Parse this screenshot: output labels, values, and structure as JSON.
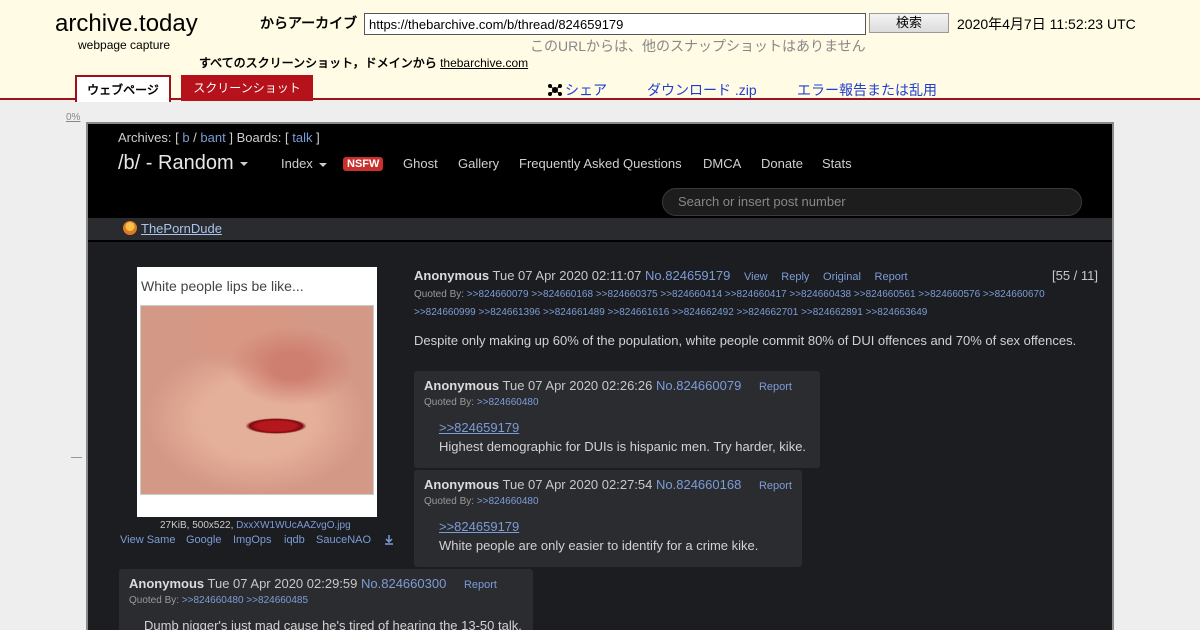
{
  "archive_header": {
    "logo": "archive.today",
    "logo_sub": "webpage capture",
    "from_label": "からアーカイブ",
    "url_value": "https://thebarchive.com/b/thread/824659179",
    "search_button": "検索",
    "capture_date": "2020年4月7日 11:52:23 UTC",
    "no_snapshots": "このURLからは、他のスナップショットはありません",
    "all_screenshots_label": "すべてのスクリーンショット，ドメインから",
    "domain_link": "thebarchive.com",
    "tabs": [
      "ウェブページ",
      "スクリーンショット"
    ],
    "share": "シェア",
    "download": "ダウンロード .zip",
    "report": "エラー報告または乱用"
  },
  "rail": {
    "percent": "0%"
  },
  "board": {
    "archives_prefix": "Archives: [",
    "archive_b": "b",
    "archive_sep": "/",
    "archive_bant": "bant",
    "boards_prefix": "] Boards: [",
    "board_talk": "talk",
    "boards_suffix": "]",
    "title": "/b/ - Random",
    "nav": [
      "Index",
      "NSFW",
      "Ghost",
      "Gallery",
      "Frequently Asked Questions",
      "DMCA",
      "Donate",
      "Stats"
    ],
    "search_placeholder": "Search or insert post number",
    "ad_link": "ThePornDude"
  },
  "op": {
    "image_caption": "White people lips be like...",
    "file_info": "27KiB, 500x522,",
    "file_name": "DxxXW1WUcAAZvgO.jpg",
    "image_links": [
      "View Same",
      "Google",
      "ImgOps",
      "iqdb",
      "SauceNAO"
    ],
    "name": "Anonymous",
    "date": "Tue 07 Apr 2020 02:11:07",
    "number": "No.824659179",
    "actions": [
      "View",
      "Reply",
      "Original",
      "Report"
    ],
    "counter": "[55 / 11]",
    "quoted_label": "Quoted By:",
    "quoted_line1": ">>824660079 >>824660168 >>824660375 >>824660414 >>824660417 >>824660438 >>824660561 >>824660576 >>824660670",
    "quoted_line2": ">>824660999 >>824661396 >>824661489 >>824661616 >>824662492 >>824662701 >>824662891 >>824663649",
    "text": "Despite only making up 60% of the population, white people commit 80% of DUI offences and 70% of sex offences."
  },
  "replies": [
    {
      "name": "Anonymous",
      "date": "Tue 07 Apr 2020 02:26:26",
      "number": "No.824660079",
      "action": "Report",
      "quoted_label": "Quoted By:",
      "quoted": ">>824660480",
      "greenlink": ">>824659179",
      "text": "Highest demographic for DUIs is hispanic men. Try harder, kike."
    },
    {
      "name": "Anonymous",
      "date": "Tue 07 Apr 2020 02:27:54",
      "number": "No.824660168",
      "action": "Report",
      "quoted_label": "Quoted By:",
      "quoted": ">>824660480",
      "greenlink": ">>824659179",
      "text": "White people are only easier to identify for a crime kike."
    },
    {
      "name": "Anonymous",
      "date": "Tue 07 Apr 2020 02:29:59",
      "number": "No.824660300",
      "action": "Report",
      "quoted_label": "Quoted By:",
      "quoted": ">>824660480 >>824660485",
      "text": "Dumb nigger's just mad cause he's tired of hearing the 13-50 talk."
    }
  ],
  "colors": {
    "archive_accent": "#a0101a",
    "board_bg": "#1c1d21",
    "link": "#7c9cd6",
    "nsfw": "#c9302c"
  }
}
